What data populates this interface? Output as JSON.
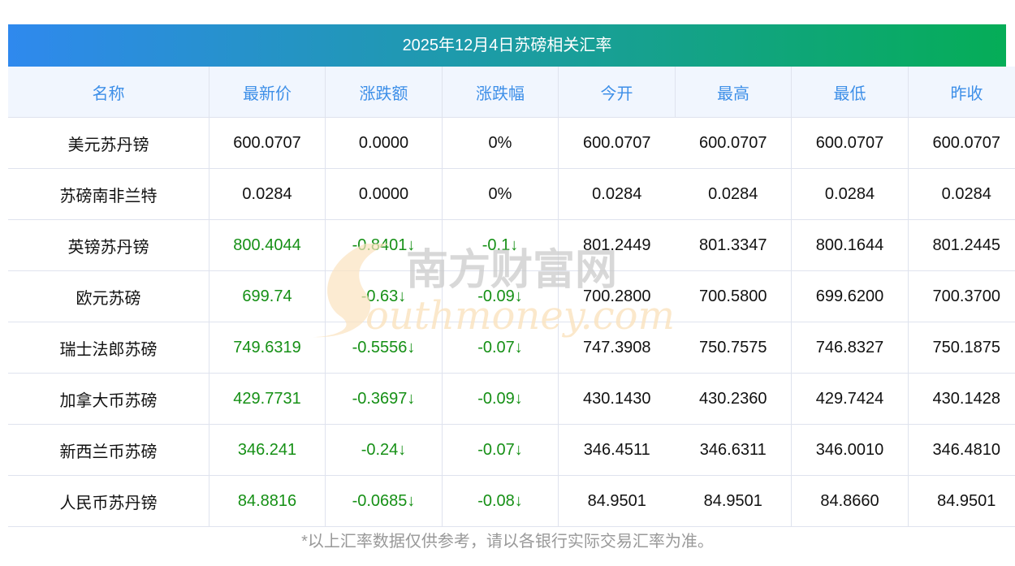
{
  "title": "2025年12月4日苏磅相关汇率",
  "headers": [
    "名称",
    "最新价",
    "涨跌额",
    "涨跌幅",
    "今开",
    "最高",
    "最低",
    "昨收"
  ],
  "rows": [
    {
      "name": "美元苏丹镑",
      "latest": "600.0707",
      "change": "0.0000",
      "pct": "0%",
      "open": "600.0707",
      "high": "600.0707",
      "low": "600.0707",
      "prev": "600.0707",
      "down": false
    },
    {
      "name": "苏磅南非兰特",
      "latest": "0.0284",
      "change": "0.0000",
      "pct": "0%",
      "open": "0.0284",
      "high": "0.0284",
      "low": "0.0284",
      "prev": "0.0284",
      "down": false
    },
    {
      "name": "英镑苏丹镑",
      "latest": "800.4044",
      "change": "-0.8401↓",
      "pct": "-0.1↓",
      "open": "801.2449",
      "high": "801.3347",
      "low": "800.1644",
      "prev": "801.2445",
      "down": true
    },
    {
      "name": "欧元苏磅",
      "latest": "699.74",
      "change": "-0.63↓",
      "pct": "-0.09↓",
      "open": "700.2800",
      "high": "700.5800",
      "low": "699.6200",
      "prev": "700.3700",
      "down": true
    },
    {
      "name": "瑞士法郎苏磅",
      "latest": "749.6319",
      "change": "-0.5556↓",
      "pct": "-0.07↓",
      "open": "747.3908",
      "high": "750.7575",
      "low": "746.8327",
      "prev": "750.1875",
      "down": true
    },
    {
      "name": "加拿大币苏磅",
      "latest": "429.7731",
      "change": "-0.3697↓",
      "pct": "-0.09↓",
      "open": "430.1430",
      "high": "430.2360",
      "low": "429.7424",
      "prev": "430.1428",
      "down": true
    },
    {
      "name": "新西兰币苏磅",
      "latest": "346.241",
      "change": "-0.24↓",
      "pct": "-0.07↓",
      "open": "346.4511",
      "high": "346.6311",
      "low": "346.0010",
      "prev": "346.4810",
      "down": true
    },
    {
      "name": "人民币苏丹镑",
      "latest": "84.8816",
      "change": "-0.0685↓",
      "pct": "-0.08↓",
      "open": "84.9501",
      "high": "84.9501",
      "low": "84.8660",
      "prev": "84.9501",
      "down": true
    }
  ],
  "watermark": {
    "cn": "南方财富网",
    "en": "southmoney.com"
  },
  "footer": "*以上汇率数据仅供参考，请以各银行实际交易汇率为准。",
  "colors": {
    "header_text": "#3d8fe8",
    "down": "#169016",
    "gradient_start": "#2f89ee",
    "gradient_end": "#05ad57"
  }
}
